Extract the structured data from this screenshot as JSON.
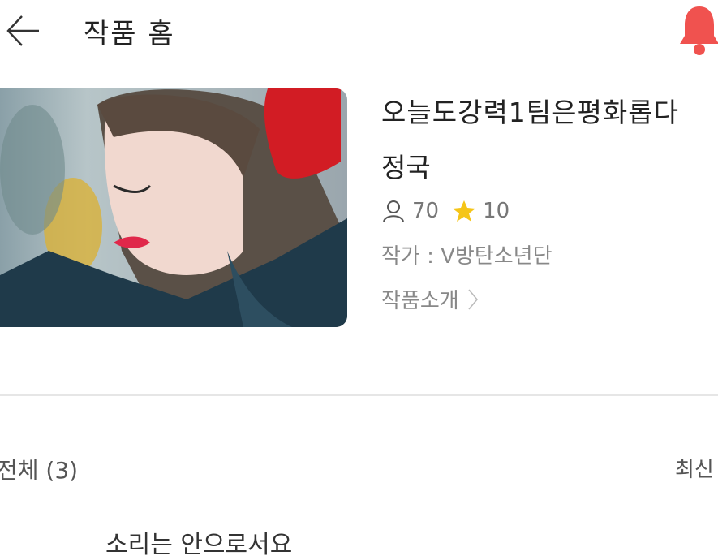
{
  "header": {
    "title": "작품 홈",
    "back_icon": "arrow-left-icon",
    "bell_icon": "bell-icon",
    "bell_color": "#f0524f"
  },
  "work": {
    "title": "오늘도강력1팀은평화롭다",
    "subtitle": "정국",
    "views": "70",
    "stars": "10",
    "author_label": "작가 : ",
    "author_name": "V방탄소년단",
    "intro_label": "작품소개",
    "star_color": "#f5c518"
  },
  "list": {
    "filter_label": "전체 (3)",
    "sort_label": "최신",
    "first_item": "소리는 안으로서요"
  }
}
